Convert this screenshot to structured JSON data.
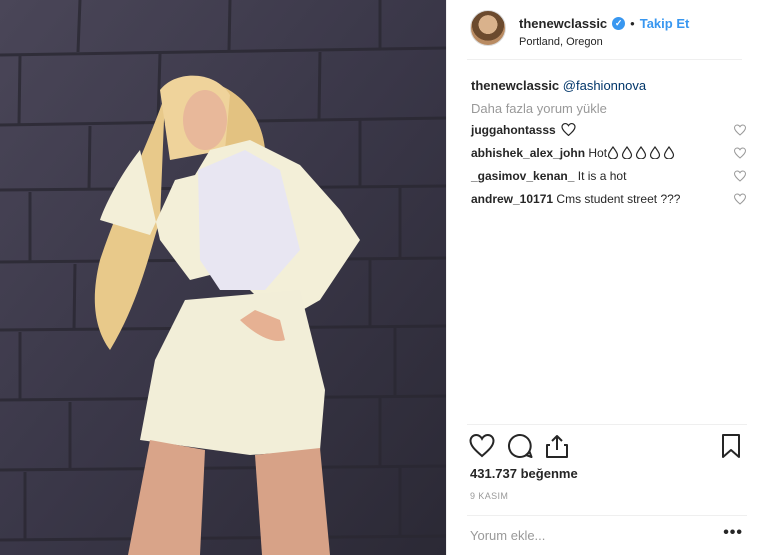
{
  "post": {
    "username": "thenewclassic",
    "follow_label": "Takip Et",
    "location": "Portland, Oregon",
    "caption": {
      "username": "thenewclassic",
      "mention": "@fashionnova"
    },
    "load_more_label": "Daha fazla yorum yükle",
    "comments": [
      {
        "username": "juggahontasss",
        "text": ""
      },
      {
        "username": "abhishek_alex_john",
        "text": "Hot"
      },
      {
        "username": "_gasimov_kenan_",
        "text": "It is a hot"
      },
      {
        "username": "andrew_10171",
        "text": "Cms student street ???"
      }
    ],
    "likes_label": "431.737 beğenme",
    "date_label": "9 KASIM",
    "comment_placeholder": "Yorum ekle...",
    "more_label": "•••"
  },
  "colors": {
    "link": "#3897f0",
    "mention": "#003569",
    "muted": "#999999"
  },
  "icons": [
    "verified-badge-icon",
    "heart-icon",
    "comment-icon",
    "share-icon",
    "bookmark-icon",
    "droplet-icon",
    "more-options-icon"
  ]
}
